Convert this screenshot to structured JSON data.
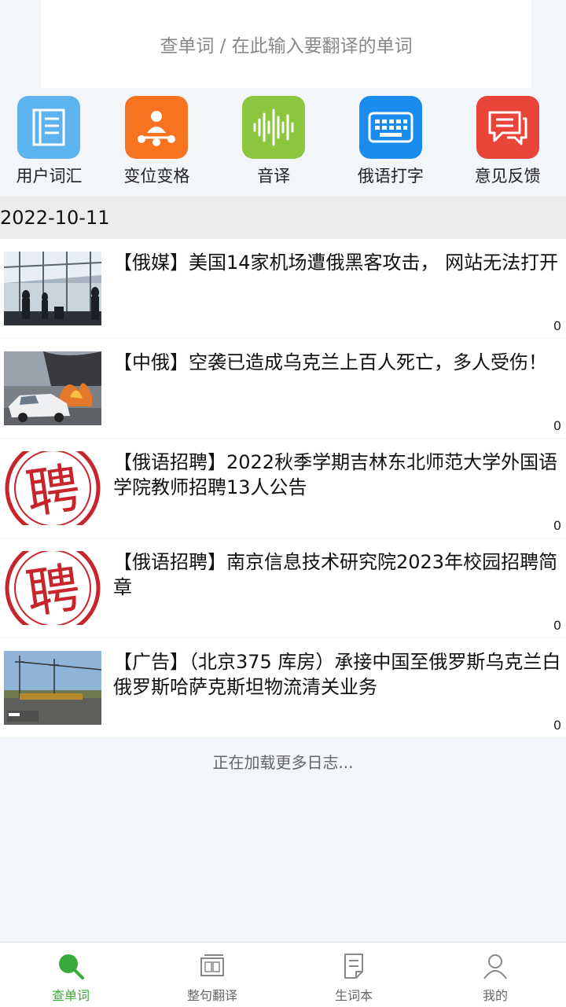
{
  "search": {
    "placeholder": "查单词 / 在此输入要翻译的单词"
  },
  "quick_actions": [
    {
      "label": "用户词汇",
      "icon": "notebook-icon",
      "color": "#5cb3ee"
    },
    {
      "label": "变位变格",
      "icon": "network-icon",
      "color": "#f7731f"
    },
    {
      "label": "音译",
      "icon": "soundwave-icon",
      "color": "#8cc63f"
    },
    {
      "label": "俄语打字",
      "icon": "keyboard-icon",
      "color": "#1a8cf0"
    },
    {
      "label": "意见反馈",
      "icon": "feedback-icon",
      "color": "#e8443a"
    }
  ],
  "date": "2022-10-11",
  "news": [
    {
      "title": "【俄媒】美国14家机场遭俄黑客攻击， 网站无法打开",
      "count": "0",
      "thumb": "airport-photo"
    },
    {
      "title": "【中俄】空袭已造成乌克兰上百人死亡，多人受伤！",
      "count": "0",
      "thumb": "burning-car-photo"
    },
    {
      "title": "【俄语招聘】2022秋季学期吉林东北师范大学外国语学院教师招聘13人公告",
      "count": "0",
      "thumb": "hiring-stamp"
    },
    {
      "title": "【俄语招聘】南京信息技术研究院2023年校园招聘简章",
      "count": "0",
      "thumb": "hiring-stamp"
    },
    {
      "title": "【广告】（北京375 库房）承接中国至俄罗斯乌克兰白俄罗斯哈萨克斯坦物流清关业务",
      "count": "0",
      "thumb": "warehouse-photo"
    }
  ],
  "stamp_char": "聘",
  "loading_text": "正在加载更多日志...",
  "tabs": [
    {
      "label": "查单词",
      "icon": "search-icon",
      "active": true
    },
    {
      "label": "整句翻译",
      "icon": "translate-icon",
      "active": false
    },
    {
      "label": "生词本",
      "icon": "wordbook-icon",
      "active": false
    },
    {
      "label": "我的",
      "icon": "user-icon",
      "active": false
    }
  ],
  "colors": {
    "active_tab": "#3aaa3a",
    "stamp_red": "#c8242c"
  }
}
